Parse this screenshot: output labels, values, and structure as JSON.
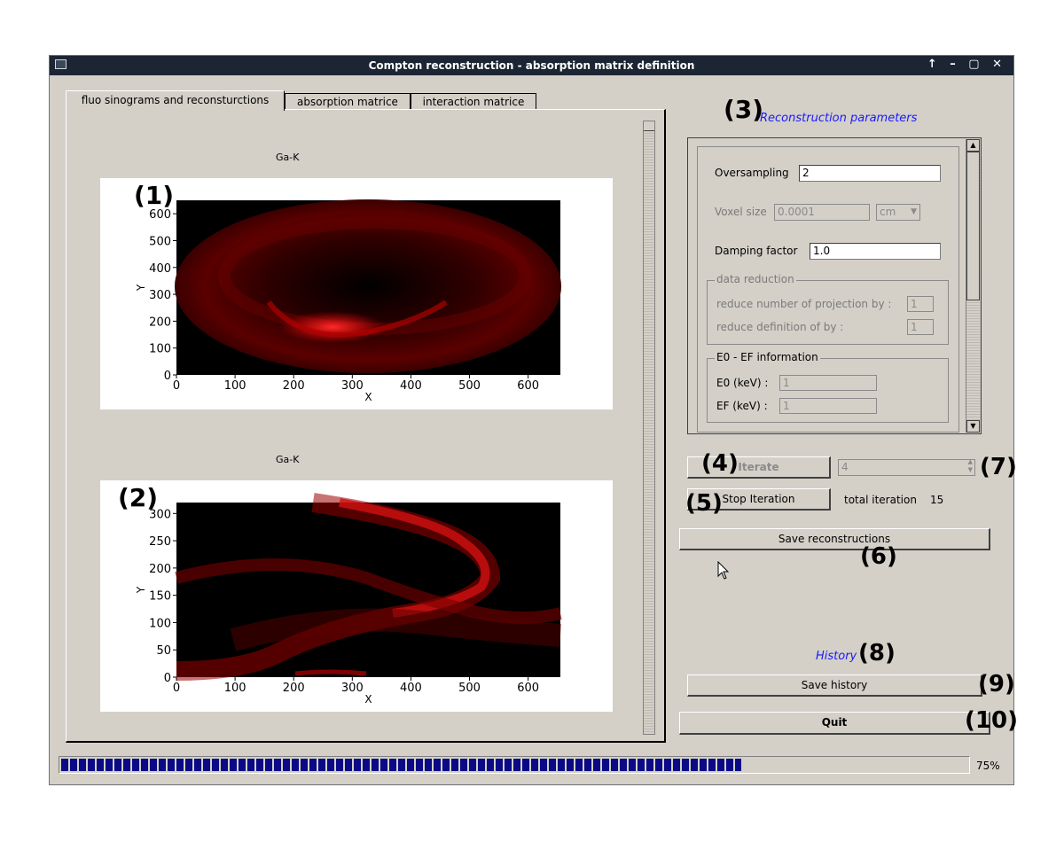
{
  "window": {
    "title": "Compton reconstruction - absorption matrix definition",
    "controls": "↑ – ▢ ✕"
  },
  "tabs": [
    {
      "label": "fluo sinograms and reconsturctions",
      "active": true
    },
    {
      "label": "absorption matrice",
      "active": false
    },
    {
      "label": "interaction matrice",
      "active": false
    }
  ],
  "plots": [
    {
      "title": "Ga-K",
      "annotation": "(1)",
      "xlabel": "X",
      "ylabel": "Y",
      "xticks": [
        "0",
        "100",
        "200",
        "300",
        "400",
        "500",
        "600"
      ],
      "yticks": [
        "0",
        "100",
        "200",
        "300",
        "400",
        "500",
        "600"
      ],
      "xlim": [
        0,
        655
      ],
      "ylim": [
        0,
        650
      ]
    },
    {
      "title": "Ga-K",
      "annotation": "(2)",
      "xlabel": "X",
      "ylabel": "Y",
      "xticks": [
        "0",
        "100",
        "200",
        "300",
        "400",
        "500",
        "600"
      ],
      "yticks": [
        "0",
        "50",
        "100",
        "150",
        "200",
        "250",
        "300"
      ],
      "xlim": [
        0,
        655
      ],
      "ylim": [
        0,
        320
      ]
    }
  ],
  "params": {
    "annotation": "(3)",
    "title": "Reconstruction parameters",
    "oversampling_label": "Oversampling",
    "oversampling_value": "2",
    "voxel_label": "Voxel size",
    "voxel_value": "0.0001",
    "voxel_unit": "cm",
    "damping_label": "Damping factor",
    "damping_value": "1.0",
    "data_reduction_title": "data reduction",
    "reduce_proj_label": "reduce number of projection by :",
    "reduce_proj_value": "1",
    "reduce_def_label": "reduce definition of by :",
    "reduce_def_value": "1",
    "e0ef_title": "E0 - EF information",
    "e0_label": "E0 (keV) :",
    "e0_value": "1",
    "ef_label": "EF (keV) :",
    "ef_value": "1"
  },
  "controls": {
    "iterate_label": "Iterate",
    "iterate_annotation": "(4)",
    "iter_count_value": "4",
    "iter_count_annotation": "(7)",
    "stop_label": "Stop Iteration",
    "stop_annotation": "(5)",
    "total_iteration_label": "total iteration",
    "total_iteration_value": "15",
    "save_recon_label": "Save reconstructions",
    "save_recon_annotation": "(6)",
    "history_label": "History",
    "history_annotation": "(8)",
    "save_history_label": "Save history",
    "save_history_annotation": "(9)",
    "quit_label": "Quit",
    "quit_annotation": "(10)"
  },
  "progress": {
    "fraction": 0.75,
    "label": "75%"
  },
  "colors": {
    "titlebar": "#1c2533",
    "window_bg": "#d4d0c8",
    "progress_fill": "#0a0a87",
    "link_blue": "#1a1aff"
  }
}
